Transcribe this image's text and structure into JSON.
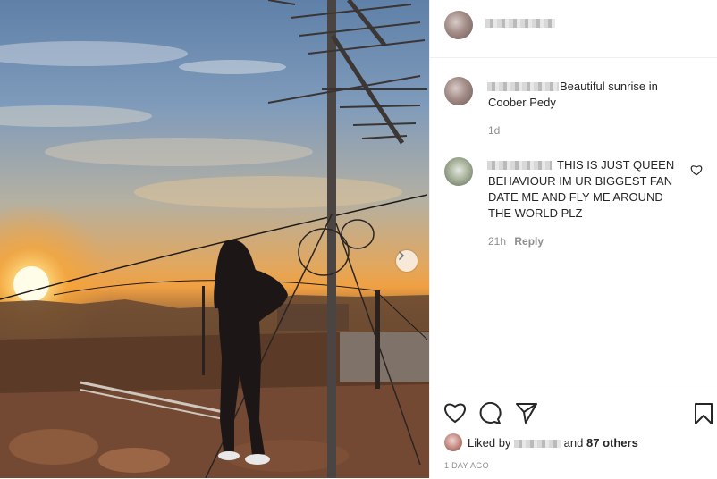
{
  "post": {
    "caption_text": "Beautiful sunrise in Coober Pedy",
    "caption_time": "1d"
  },
  "comments": [
    {
      "text": "THIS IS JUST QUEEN BEHAVIOUR IM UR BIGGEST FAN DATE ME AND FLY ME AROUND THE WORLD PLZ",
      "time": "21h",
      "reply_label": "Reply"
    }
  ],
  "likes": {
    "prefix": "Liked by",
    "connector": "and",
    "others": "87 others"
  },
  "posted_ago": "1 DAY AGO",
  "icons": [
    "heart-icon",
    "comment-icon",
    "share-icon",
    "bookmark-icon",
    "chevron-right-icon",
    "comment-like-icon"
  ]
}
